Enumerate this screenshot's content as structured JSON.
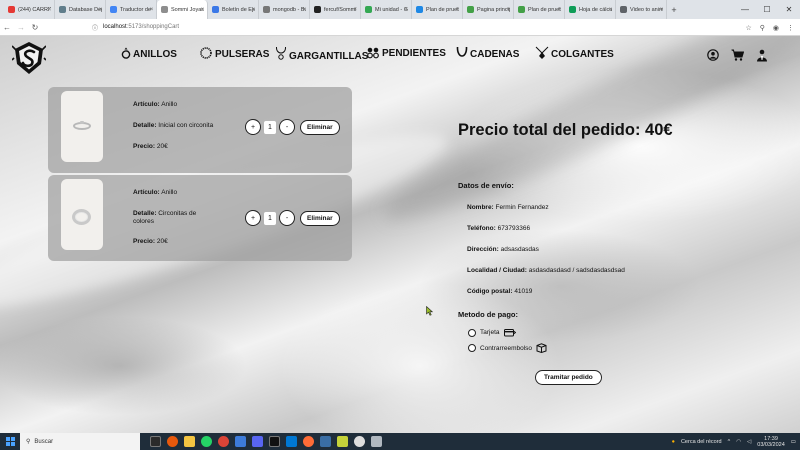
{
  "browser": {
    "tabs": [
      {
        "label": "(244) CARRITO",
        "color": "#e53935"
      },
      {
        "label": "Database Depl",
        "color": "#607d8b"
      },
      {
        "label": "Traductor de G",
        "color": "#4285f4"
      },
      {
        "label": "Sommi Joyas",
        "color": "#8e8e8e",
        "active": true
      },
      {
        "label": "Boletín de Ejer",
        "color": "#3b78e7"
      },
      {
        "label": "mongodb - Buscar",
        "color": "#777777"
      },
      {
        "label": "fercuf/Sommi",
        "color": "#222222"
      },
      {
        "label": "Mi unidad - Goo",
        "color": "#34a853"
      },
      {
        "label": "Plan de prueba",
        "color": "#1e88e5"
      },
      {
        "label": "Pagina principal",
        "color": "#43a047"
      },
      {
        "label": "Plan de prueba",
        "color": "#43a047"
      },
      {
        "label": "Hoja de cálculo sin",
        "color": "#0f9d58"
      },
      {
        "label": "Video to anim",
        "color": "#5f6368"
      }
    ],
    "url_prefix": "localhost",
    "url_rest": ":5173/shoppingCart"
  },
  "nav": {
    "categories": [
      "ANILLOS",
      "PULSERAS",
      "GARGANTILLAS",
      "PENDIENTES",
      "CADENAS",
      "COLGANTES"
    ]
  },
  "labels": {
    "articulo": "Artículo:",
    "detalle": "Detalle:",
    "precio": "Precio:",
    "eliminar": "Eliminar",
    "plus": "+",
    "minus": "-"
  },
  "cart": [
    {
      "articulo": "Anillo",
      "detalle": "Inicial con circonita",
      "precio": "20€",
      "qty": "1"
    },
    {
      "articulo": "Anillo",
      "detalle": "Circonitas de colores",
      "precio": "20€",
      "qty": "1"
    }
  ],
  "summary": {
    "total": "Precio total del pedido: 40€",
    "shipping_title": "Datos de envío:",
    "fields": [
      {
        "label": "Nombre:",
        "value": "Fermin Fernandez"
      },
      {
        "label": "Teléfono:",
        "value": "673793366"
      },
      {
        "label": "Dirección:",
        "value": "adsasdasdas"
      },
      {
        "label": "Localidad / Ciudad:",
        "value": "asdasdasdasd / sadsdasdasdsad"
      },
      {
        "label": "Código postal:",
        "value": "41019"
      }
    ],
    "payment_title": "Metodo de pago:",
    "payment_options": [
      "Tarjeta",
      "Contrarreembolso"
    ],
    "submit": "Tramitar pedido"
  },
  "taskbar": {
    "search_placeholder": "Buscar",
    "tray_text": "Cerca del récord",
    "time": "17:39",
    "date": "03/03/2024"
  }
}
